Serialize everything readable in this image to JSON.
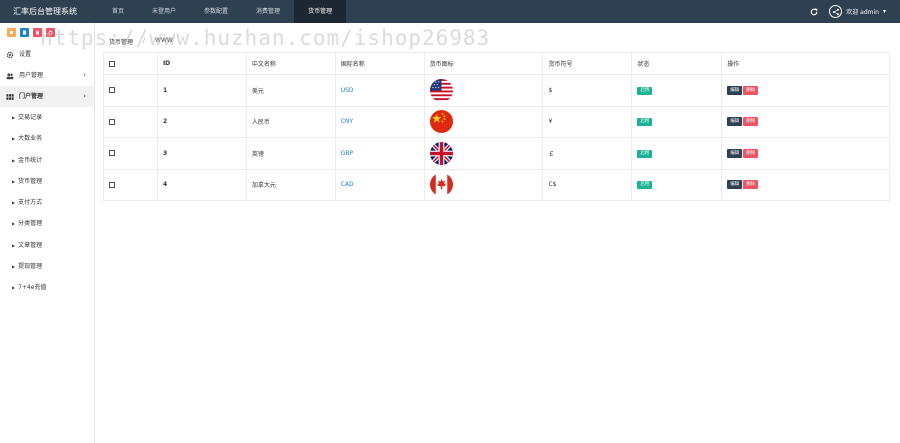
{
  "app": {
    "title": "汇率后台管理系统"
  },
  "topnav": {
    "items": [
      {
        "label": "首页",
        "active": false
      },
      {
        "label": "未登用户",
        "active": false
      },
      {
        "label": "参数配置",
        "active": false
      },
      {
        "label": "消费管理",
        "active": false
      },
      {
        "label": "货币管理",
        "active": true
      }
    ]
  },
  "user": {
    "greeting": "欢迎 admin",
    "caret": "▾",
    "refresh_icon": "refresh-icon",
    "avatar_icon": "share-icon"
  },
  "quick_buttons": [
    {
      "icon": "bookmark-icon",
      "color": "#f8ac59"
    },
    {
      "icon": "document-icon",
      "color": "#1c84c6"
    },
    {
      "icon": "trash-icon",
      "color": "#ed5565"
    },
    {
      "icon": "power-icon",
      "color": "#ed5565"
    }
  ],
  "sidebar": {
    "items": [
      {
        "label": "设置",
        "icon": "gear-icon",
        "has_arrow": false,
        "open": false
      },
      {
        "label": "用户管理",
        "icon": "users-icon",
        "has_arrow": true,
        "open": false
      },
      {
        "label": "门户管理",
        "icon": "grid-icon",
        "has_arrow": true,
        "open": true
      }
    ],
    "sub_items": [
      "交易记录",
      "大数业务",
      "金币统计",
      "货币管理",
      "支付方式",
      "分类管理",
      "文章管理",
      "提现管理",
      "7+4e充值"
    ],
    "arrow": "›"
  },
  "breadcrumb": {
    "current": "货币管理",
    "separator": "/",
    "tail": "WWW"
  },
  "table": {
    "headers": [
      "",
      "ID",
      "中文名称",
      "国际名称",
      "货币图标",
      "货币符号",
      "状态",
      "操作"
    ],
    "rows": [
      {
        "id": "1",
        "cn_name": "美元",
        "code": "USD",
        "flag": "us-flag-icon",
        "symbol": "$",
        "status": "启用",
        "edit": "编辑",
        "delete": "删除"
      },
      {
        "id": "2",
        "cn_name": "人民币",
        "code": "CNY",
        "flag": "cn-flag-icon",
        "symbol": "¥",
        "status": "启用",
        "edit": "编辑",
        "delete": "删除"
      },
      {
        "id": "3",
        "cn_name": "英镑",
        "code": "GBP",
        "flag": "uk-flag-icon",
        "symbol": "￡",
        "status": "启用",
        "edit": "编辑",
        "delete": "删除"
      },
      {
        "id": "4",
        "cn_name": "加拿大元",
        "code": "CAD",
        "flag": "ca-flag-icon",
        "symbol": "C$",
        "status": "启用",
        "edit": "编辑",
        "delete": "删除"
      }
    ]
  },
  "colors": {
    "topbar": "#2f4050",
    "active_nav": "#1d2733",
    "status_green": "#1ab394",
    "edit_dark": "#2f4050",
    "delete_red": "#ed5565"
  },
  "watermark": "https://www.huzhan.com/ishop26983"
}
